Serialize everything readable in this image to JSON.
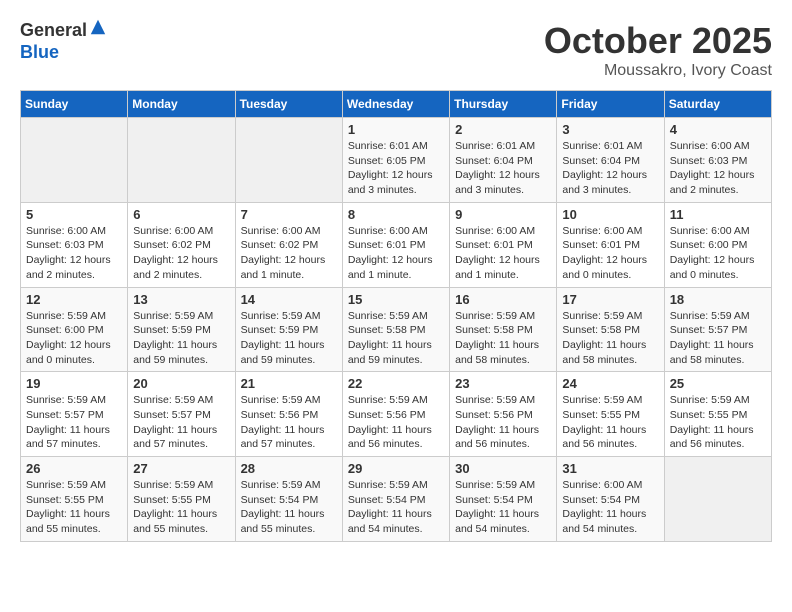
{
  "header": {
    "logo_line1": "General",
    "logo_line2": "Blue",
    "month": "October 2025",
    "location": "Moussakro, Ivory Coast"
  },
  "weekdays": [
    "Sunday",
    "Monday",
    "Tuesday",
    "Wednesday",
    "Thursday",
    "Friday",
    "Saturday"
  ],
  "weeks": [
    [
      {
        "day": "",
        "info": ""
      },
      {
        "day": "",
        "info": ""
      },
      {
        "day": "",
        "info": ""
      },
      {
        "day": "1",
        "info": "Sunrise: 6:01 AM\nSunset: 6:05 PM\nDaylight: 12 hours and 3 minutes."
      },
      {
        "day": "2",
        "info": "Sunrise: 6:01 AM\nSunset: 6:04 PM\nDaylight: 12 hours and 3 minutes."
      },
      {
        "day": "3",
        "info": "Sunrise: 6:01 AM\nSunset: 6:04 PM\nDaylight: 12 hours and 3 minutes."
      },
      {
        "day": "4",
        "info": "Sunrise: 6:00 AM\nSunset: 6:03 PM\nDaylight: 12 hours and 2 minutes."
      }
    ],
    [
      {
        "day": "5",
        "info": "Sunrise: 6:00 AM\nSunset: 6:03 PM\nDaylight: 12 hours and 2 minutes."
      },
      {
        "day": "6",
        "info": "Sunrise: 6:00 AM\nSunset: 6:02 PM\nDaylight: 12 hours and 2 minutes."
      },
      {
        "day": "7",
        "info": "Sunrise: 6:00 AM\nSunset: 6:02 PM\nDaylight: 12 hours and 1 minute."
      },
      {
        "day": "8",
        "info": "Sunrise: 6:00 AM\nSunset: 6:01 PM\nDaylight: 12 hours and 1 minute."
      },
      {
        "day": "9",
        "info": "Sunrise: 6:00 AM\nSunset: 6:01 PM\nDaylight: 12 hours and 1 minute."
      },
      {
        "day": "10",
        "info": "Sunrise: 6:00 AM\nSunset: 6:01 PM\nDaylight: 12 hours and 0 minutes."
      },
      {
        "day": "11",
        "info": "Sunrise: 6:00 AM\nSunset: 6:00 PM\nDaylight: 12 hours and 0 minutes."
      }
    ],
    [
      {
        "day": "12",
        "info": "Sunrise: 5:59 AM\nSunset: 6:00 PM\nDaylight: 12 hours and 0 minutes."
      },
      {
        "day": "13",
        "info": "Sunrise: 5:59 AM\nSunset: 5:59 PM\nDaylight: 11 hours and 59 minutes."
      },
      {
        "day": "14",
        "info": "Sunrise: 5:59 AM\nSunset: 5:59 PM\nDaylight: 11 hours and 59 minutes."
      },
      {
        "day": "15",
        "info": "Sunrise: 5:59 AM\nSunset: 5:58 PM\nDaylight: 11 hours and 59 minutes."
      },
      {
        "day": "16",
        "info": "Sunrise: 5:59 AM\nSunset: 5:58 PM\nDaylight: 11 hours and 58 minutes."
      },
      {
        "day": "17",
        "info": "Sunrise: 5:59 AM\nSunset: 5:58 PM\nDaylight: 11 hours and 58 minutes."
      },
      {
        "day": "18",
        "info": "Sunrise: 5:59 AM\nSunset: 5:57 PM\nDaylight: 11 hours and 58 minutes."
      }
    ],
    [
      {
        "day": "19",
        "info": "Sunrise: 5:59 AM\nSunset: 5:57 PM\nDaylight: 11 hours and 57 minutes."
      },
      {
        "day": "20",
        "info": "Sunrise: 5:59 AM\nSunset: 5:57 PM\nDaylight: 11 hours and 57 minutes."
      },
      {
        "day": "21",
        "info": "Sunrise: 5:59 AM\nSunset: 5:56 PM\nDaylight: 11 hours and 57 minutes."
      },
      {
        "day": "22",
        "info": "Sunrise: 5:59 AM\nSunset: 5:56 PM\nDaylight: 11 hours and 56 minutes."
      },
      {
        "day": "23",
        "info": "Sunrise: 5:59 AM\nSunset: 5:56 PM\nDaylight: 11 hours and 56 minutes."
      },
      {
        "day": "24",
        "info": "Sunrise: 5:59 AM\nSunset: 5:55 PM\nDaylight: 11 hours and 56 minutes."
      },
      {
        "day": "25",
        "info": "Sunrise: 5:59 AM\nSunset: 5:55 PM\nDaylight: 11 hours and 56 minutes."
      }
    ],
    [
      {
        "day": "26",
        "info": "Sunrise: 5:59 AM\nSunset: 5:55 PM\nDaylight: 11 hours and 55 minutes."
      },
      {
        "day": "27",
        "info": "Sunrise: 5:59 AM\nSunset: 5:55 PM\nDaylight: 11 hours and 55 minutes."
      },
      {
        "day": "28",
        "info": "Sunrise: 5:59 AM\nSunset: 5:54 PM\nDaylight: 11 hours and 55 minutes."
      },
      {
        "day": "29",
        "info": "Sunrise: 5:59 AM\nSunset: 5:54 PM\nDaylight: 11 hours and 54 minutes."
      },
      {
        "day": "30",
        "info": "Sunrise: 5:59 AM\nSunset: 5:54 PM\nDaylight: 11 hours and 54 minutes."
      },
      {
        "day": "31",
        "info": "Sunrise: 6:00 AM\nSunset: 5:54 PM\nDaylight: 11 hours and 54 minutes."
      },
      {
        "day": "",
        "info": ""
      }
    ]
  ]
}
